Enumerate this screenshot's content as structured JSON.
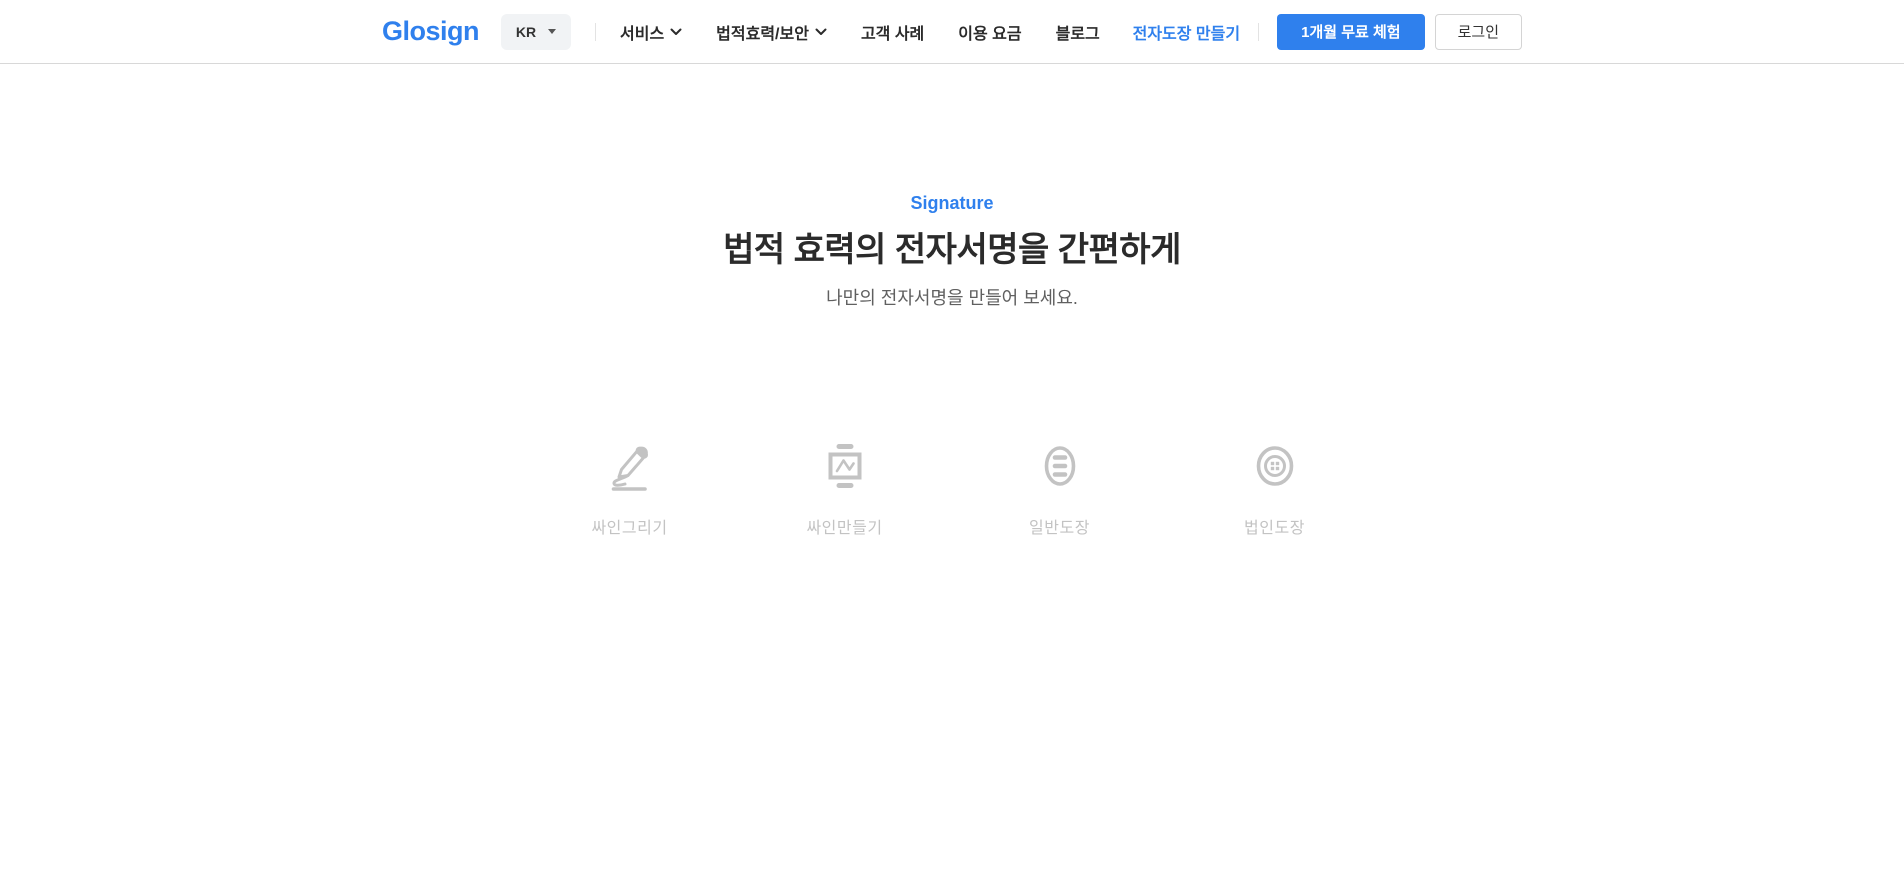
{
  "header": {
    "logo": "Glosign",
    "language": {
      "selected": "KR"
    },
    "nav": [
      {
        "label": "서비스",
        "has_dropdown": true
      },
      {
        "label": "법적효력/보안",
        "has_dropdown": true
      },
      {
        "label": "고객 사례",
        "has_dropdown": false
      },
      {
        "label": "이용 요금",
        "has_dropdown": false
      },
      {
        "label": "블로그",
        "has_dropdown": false
      }
    ],
    "stamp_link": "전자도장 만들기",
    "trial_button": "1개월 무료 체험",
    "login_button": "로그인"
  },
  "hero": {
    "eyebrow": "Signature",
    "title": "법적 효력의 전자서명을 간편하게",
    "subtitle": "나만의 전자서명을 만들어 보세요."
  },
  "signature_options": [
    {
      "label": "싸인그리기",
      "icon": "draw-sign-icon"
    },
    {
      "label": "싸인만들기",
      "icon": "make-sign-icon"
    },
    {
      "label": "일반도장",
      "icon": "round-stamp-icon"
    },
    {
      "label": "법인도장",
      "icon": "corporate-stamp-icon"
    }
  ],
  "colors": {
    "accent": "#2F80ED",
    "heading": "#2b2b2b",
    "muted": "#606060",
    "inactive": "#c3c3c3",
    "header_border": "#d8d8d8"
  }
}
